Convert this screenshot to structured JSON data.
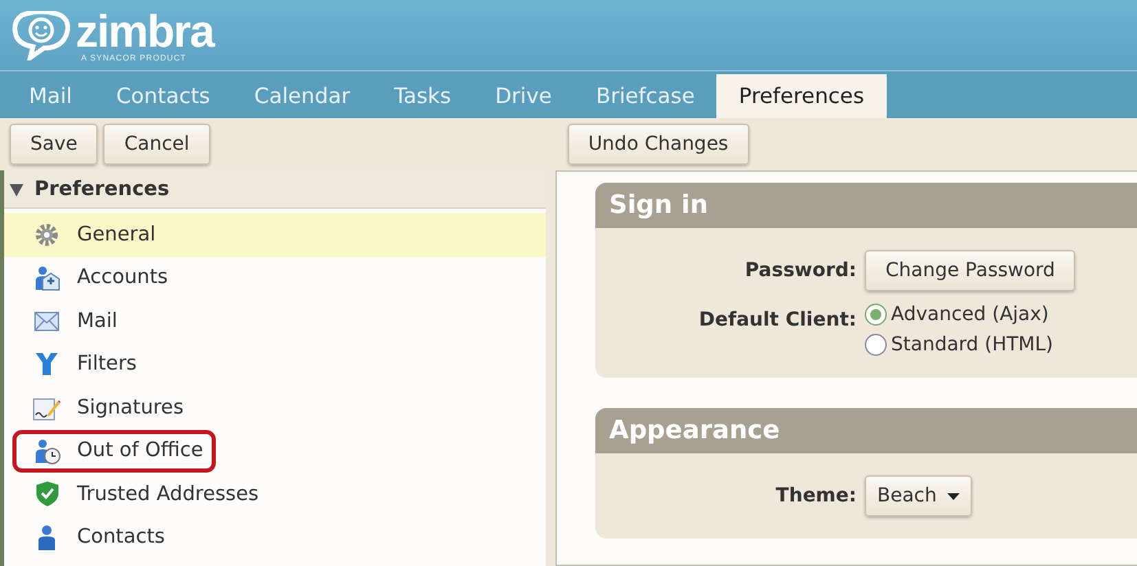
{
  "logo": {
    "name": "zimbra",
    "tagline": "A SYNACOR PRODUCT"
  },
  "tabs": [
    {
      "label": "Mail",
      "selected": false
    },
    {
      "label": "Contacts",
      "selected": false
    },
    {
      "label": "Calendar",
      "selected": false
    },
    {
      "label": "Tasks",
      "selected": false
    },
    {
      "label": "Drive",
      "selected": false
    },
    {
      "label": "Briefcase",
      "selected": false
    },
    {
      "label": "Preferences",
      "selected": true
    }
  ],
  "toolbar": {
    "left_buttons": [
      "Save",
      "Cancel"
    ],
    "right_buttons": [
      "Undo Changes"
    ]
  },
  "tree": {
    "title": "Preferences",
    "expanded": true,
    "items": [
      {
        "label": "General",
        "kind": "gear",
        "selected": true,
        "circled": false
      },
      {
        "label": "Accounts",
        "kind": "accounts",
        "selected": false,
        "circled": false
      },
      {
        "label": "Mail",
        "kind": "mail",
        "selected": false,
        "circled": false
      },
      {
        "label": "Filters",
        "kind": "filters",
        "selected": false,
        "circled": false
      },
      {
        "label": "Signatures",
        "kind": "signatures",
        "selected": false,
        "circled": false
      },
      {
        "label": "Out of Office",
        "kind": "outofoffice",
        "selected": false,
        "circled": true
      },
      {
        "label": "Trusted Addresses",
        "kind": "trusted",
        "selected": false,
        "circled": false
      },
      {
        "label": "Contacts",
        "kind": "contacts",
        "selected": false,
        "circled": false
      }
    ]
  },
  "sections": [
    {
      "title": "Sign in",
      "rows": [
        {
          "label": "Password:",
          "kind": "button",
          "value": "Change Password"
        },
        {
          "label": "Default Client:",
          "kind": "radio",
          "options": [
            {
              "label": "Advanced (Ajax)",
              "selected": true
            },
            {
              "label": "Standard (HTML)",
              "selected": false
            }
          ]
        }
      ]
    },
    {
      "title": "Appearance",
      "rows": [
        {
          "label": "Theme:",
          "kind": "select",
          "value": "Beach"
        }
      ]
    }
  ]
}
